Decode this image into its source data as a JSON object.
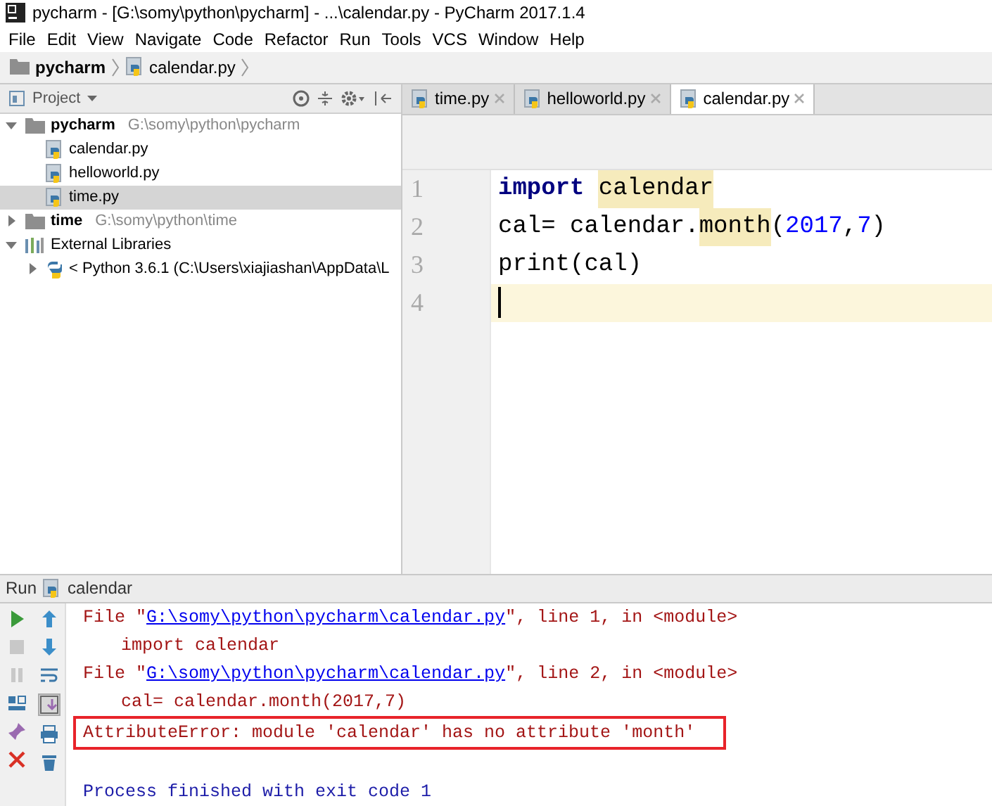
{
  "window": {
    "title": "pycharm - [G:\\somy\\python\\pycharm] - ...\\calendar.py - PyCharm 2017.1.4"
  },
  "menu": [
    "File",
    "Edit",
    "View",
    "Navigate",
    "Code",
    "Refactor",
    "Run",
    "Tools",
    "VCS",
    "Window",
    "Help"
  ],
  "breadcrumb": [
    {
      "label": "pycharm",
      "kind": "folder"
    },
    {
      "label": "calendar.py",
      "kind": "file"
    }
  ],
  "project_panel": {
    "title": "Project",
    "tree": [
      {
        "label": "pycharm",
        "path": "G:\\somy\\python\\pycharm",
        "kind": "folder",
        "expanded": true,
        "children": [
          {
            "label": "calendar.py",
            "kind": "file",
            "selected": false
          },
          {
            "label": "helloworld.py",
            "kind": "file",
            "selected": false
          },
          {
            "label": "time.py",
            "kind": "file",
            "selected": true
          }
        ]
      },
      {
        "label": "time",
        "path": "G:\\somy\\python\\time",
        "kind": "folder",
        "expanded": false
      },
      {
        "label": "External Libraries",
        "kind": "library",
        "expanded": true,
        "children": [
          {
            "label": "< Python 3.6.1 (C:\\Users\\xiajiashan\\AppData\\L",
            "kind": "python",
            "expanded": false
          }
        ]
      }
    ]
  },
  "tabs": [
    {
      "label": "time.py",
      "selected": false
    },
    {
      "label": "helloworld.py",
      "selected": false
    },
    {
      "label": "calendar.py",
      "selected": true
    }
  ],
  "editor": {
    "lines": [
      {
        "number": "1",
        "current": false,
        "tokens": [
          {
            "text": "import",
            "kind": "keyword"
          },
          {
            "text": "calendar",
            "kind": "highlight"
          }
        ]
      },
      {
        "number": "2",
        "current": false,
        "tokens": [
          {
            "text": "cal= calendar.",
            "kind": "plain"
          },
          {
            "text": "month",
            "kind": "highlight"
          },
          {
            "text": "(",
            "kind": "plain"
          },
          {
            "text": "2017",
            "kind": "number"
          },
          {
            "text": ",",
            "kind": "plain"
          },
          {
            "text": "7",
            "kind": "number"
          },
          {
            "text": ")",
            "kind": "plain"
          }
        ]
      },
      {
        "number": "3",
        "current": false,
        "tokens": [
          {
            "text": "print(cal)",
            "kind": "plain"
          }
        ]
      },
      {
        "number": "4",
        "current": true
      }
    ]
  },
  "run_panel": {
    "title": "Run",
    "config": "calendar",
    "lines": [
      {
        "indent": false,
        "boxed": false,
        "kind": "stderr",
        "segments": [
          {
            "text": "File \"",
            "kind": "text"
          },
          {
            "text": "G:\\somy\\python\\pycharm\\calendar.py",
            "kind": "link"
          },
          {
            "text": "\", line 1, in <module>",
            "kind": "text"
          }
        ]
      },
      {
        "indent": true,
        "boxed": false,
        "kind": "stderr",
        "segments": [
          {
            "text": "import calendar",
            "kind": "text"
          }
        ]
      },
      {
        "indent": false,
        "boxed": false,
        "kind": "stderr",
        "segments": [
          {
            "text": "File \"",
            "kind": "text"
          },
          {
            "text": "G:\\somy\\python\\pycharm\\calendar.py",
            "kind": "link"
          },
          {
            "text": "\", line 2, in <module>",
            "kind": "text"
          }
        ]
      },
      {
        "indent": true,
        "boxed": false,
        "kind": "stderr",
        "segments": [
          {
            "text": "cal= calendar.month(2017,7)",
            "kind": "text"
          }
        ]
      },
      {
        "indent": false,
        "boxed": true,
        "kind": "stderr",
        "segments": [
          {
            "text": "AttributeError: module 'calendar' has no attribute 'month'",
            "kind": "text"
          }
        ]
      },
      {
        "indent": false,
        "boxed": false,
        "kind": "system",
        "segments": [
          {
            "text": "Process finished with exit code 1",
            "kind": "text"
          }
        ]
      }
    ]
  }
}
